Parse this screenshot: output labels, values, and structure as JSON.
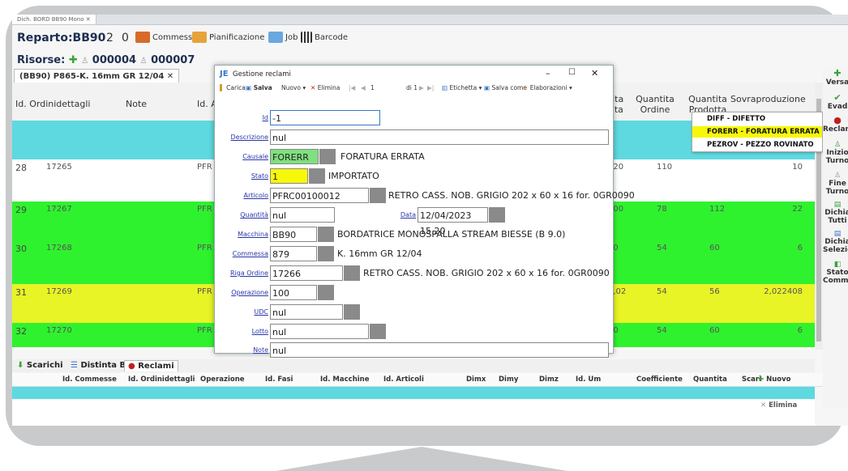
{
  "doc_tab": "Dich. BORD BB90 Mono",
  "header": {
    "reparto_label": "Reparto:BB90",
    "count_a": "2",
    "count_b": "0",
    "commessa": "Commessa",
    "pianificazione": "Pianificazione",
    "job": "Job",
    "barcode": "Barcode"
  },
  "risorse": {
    "label": "Risorse:",
    "r1": "000004",
    "r2": "000007"
  },
  "subtab": "(BB90) P865-K. 16mm GR 12/04",
  "grid": {
    "headers": [
      "Id. Ordinidettagli",
      "Note",
      "Id. A",
      "tita ata",
      "Quantita Ordine",
      "Quantita Prodotta",
      "Sovraproduzione"
    ],
    "rows": [
      {
        "n": "28",
        "id": "17265",
        "pf": "PFR",
        "a": "120",
        "ord": "110",
        "prod": "",
        "sov": "10",
        "color": "#ffffff"
      },
      {
        "n": "29",
        "id": "17267",
        "pf": "PFR",
        "a": "100",
        "ord": "78",
        "prod": "112",
        "sov": "22",
        "color": "#2ff22f"
      },
      {
        "n": "30",
        "id": "17268",
        "pf": "PFR",
        "a": "60",
        "ord": "54",
        "prod": "60",
        "sov": "6",
        "color": "#2ff22f"
      },
      {
        "n": "31",
        "id": "17269",
        "pf": "PFR",
        "a": "5,02",
        "ord": "54",
        "prod": "56",
        "sov": "2,022408",
        "color": "#e8f425"
      },
      {
        "n": "32",
        "id": "17270",
        "pf": "PFR",
        "a": "60",
        "ord": "54",
        "prod": "60",
        "sov": "6",
        "color": "#2ff22f"
      }
    ]
  },
  "dropdown": [
    "DIFF - DIFETTO",
    "FORERR - FORATURA ERRATA",
    "PEZROV - PEZZO ROVINATO"
  ],
  "rightbar": [
    "Versa",
    "Evad",
    "Reclam",
    "Inizio Turno",
    "Fine Turno",
    "Dichia Tutti",
    "Dichia Selezion",
    "Stato Comme"
  ],
  "bottom": {
    "tabs": [
      "Scarichi",
      "Distinta Base",
      "Reclami"
    ],
    "headers": [
      "Id. Commesse",
      "Id. Ordinidettagli",
      "Operazione",
      "Id. Fasi",
      "Id. Macchine",
      "Id. Articoli",
      "Dimx",
      "Dimy",
      "Dimz",
      "Id. Um",
      "Coefficiente",
      "Quantita",
      "Scari"
    ],
    "nuovo": "Nuovo",
    "elimina": "Elimina"
  },
  "dialog": {
    "title": "Gestione reclami",
    "toolbar": {
      "carica": "Carica",
      "salva": "Salva",
      "nuovo": "Nuovo",
      "elimina": "Elimina",
      "page": "1",
      "of": "di 1",
      "etichetta": "Etichetta",
      "salva_come": "Salva come",
      "elaborazioni": "Elaborazioni"
    },
    "labels": {
      "id": "Id",
      "descrizione": "Descrizione",
      "causale": "Causale",
      "stato": "Stato",
      "articolo": "Articolo",
      "quantita": "Quantità",
      "data": "Data",
      "macchina": "Macchina",
      "commessa": "Commessa",
      "riga_ordine": "Riga Ordine",
      "operazione": "Operazione",
      "udc": "UDC",
      "lotto": "Lotto",
      "note": "Note"
    },
    "values": {
      "id": "-1",
      "descrizione": "nul",
      "causale": "FORERR",
      "causale_desc": "FORATURA ERRATA",
      "stato": "1",
      "stato_desc": "IMPORTATO",
      "articolo": "PFRC00100012",
      "articolo_desc": "RETRO CASS. NOB. GRIGIO 202 x 60 x 16 for. 0GR0090",
      "quantita": "nul",
      "data": "12/04/2023 15.20",
      "macchina": "BB90",
      "macchina_desc": "BORDATRICE MONOSPALLA STREAM BIESSE (B 9.0)",
      "commessa": "879",
      "commessa_desc": "K. 16mm GR 12/04",
      "riga_ordine": "17266",
      "riga_desc": "RETRO CASS. NOB. GRIGIO 202 x 60 x 16 for. 0GR0090",
      "operazione": "100",
      "udc": "nul",
      "lotto": "nul",
      "note": "nul"
    }
  }
}
